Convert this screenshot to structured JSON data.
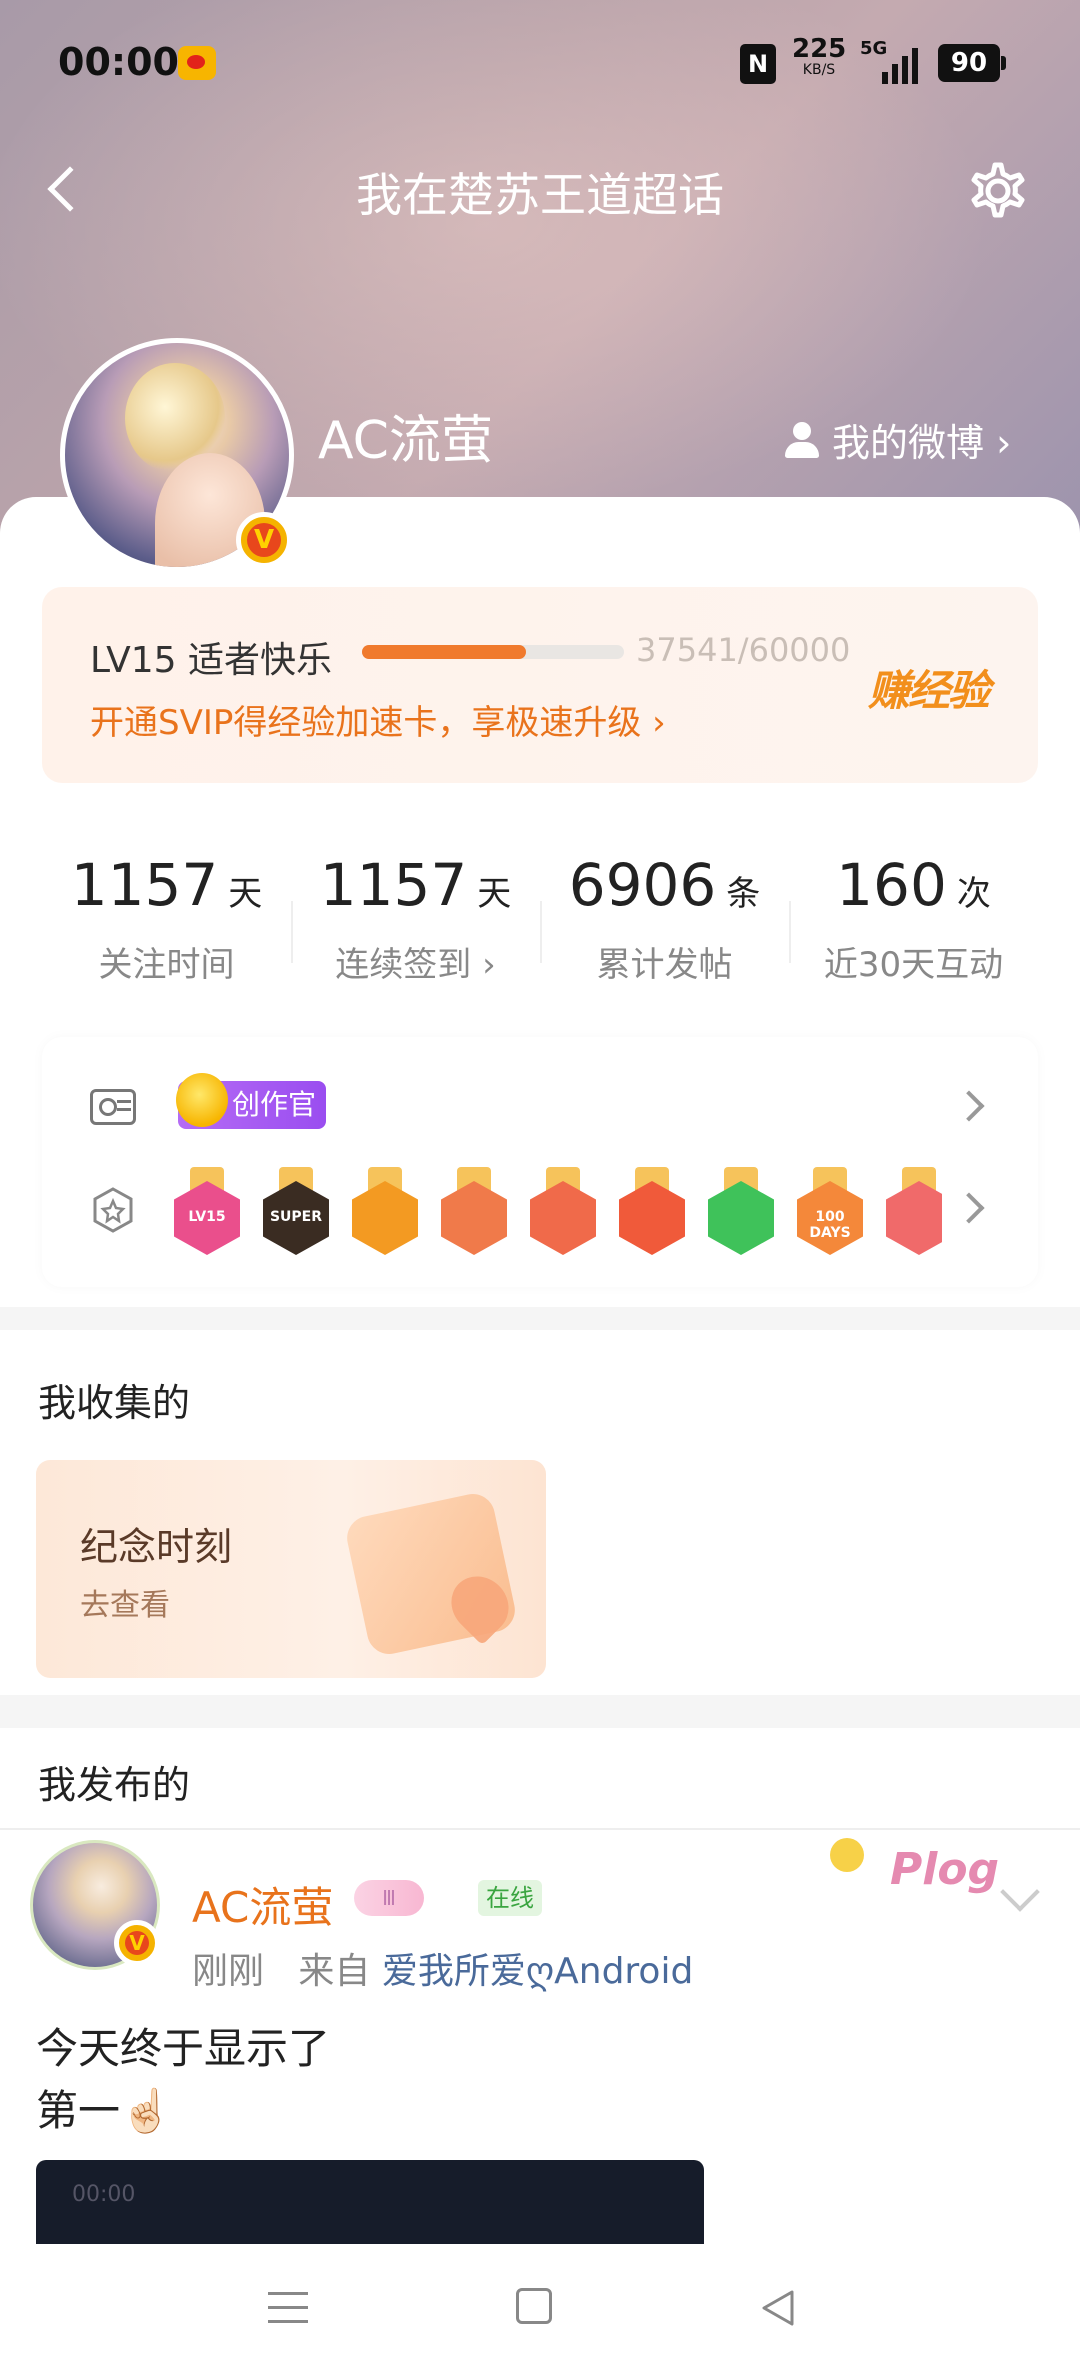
{
  "status_bar": {
    "time": "00:00",
    "nfc": "N",
    "speed_value": "225",
    "speed_unit": "KB/S",
    "network": "5G",
    "battery": "90"
  },
  "header": {
    "title": "我在楚苏王道超话",
    "username": "AC流萤",
    "my_weibo_label": "我的微博 ›"
  },
  "level": {
    "title": "LV15 适者快乐",
    "progress_text": "37541/60000",
    "progress_fraction": 0.6257,
    "promo": "开通SVIP得经验加速卡，享极速升级 ›",
    "earn_label": "赚经验"
  },
  "stats": [
    {
      "value": "1157",
      "unit": "天",
      "label": "关注时间"
    },
    {
      "value": "1157",
      "unit": "天",
      "label": "连续签到 ›"
    },
    {
      "value": "6906",
      "unit": "条",
      "label": "累计发帖"
    },
    {
      "value": "160",
      "unit": "次",
      "label": "近30天互动"
    }
  ],
  "badges": {
    "creator_tag": "创作官",
    "medals": [
      {
        "name": "lv15-medal",
        "label": "LV15",
        "color": "#ea4f8c",
        "ribbon": "#f6c35b"
      },
      {
        "name": "super-medal",
        "label": "SUPER",
        "color": "#3a2c22",
        "ribbon": "#f6c35b"
      },
      {
        "name": "crown-medal",
        "label": "",
        "color": "#f39a22",
        "ribbon": "#f6c35b"
      },
      {
        "name": "cat-medal-1",
        "label": "",
        "color": "#f07a4a",
        "ribbon": "#f6c35b"
      },
      {
        "name": "cat-medal-2",
        "label": "",
        "color": "#f06a4a",
        "ribbon": "#f6c35b"
      },
      {
        "name": "cat-medal-3",
        "label": "",
        "color": "#f05a3a",
        "ribbon": "#f6c35b"
      },
      {
        "name": "hand-medal",
        "label": "",
        "color": "#3fc25a",
        "ribbon": "#f6c35b"
      },
      {
        "name": "100-days-medal",
        "label": "100 DAYS",
        "color": "#f4883a",
        "ribbon": "#f6c35b"
      },
      {
        "name": "partial-medal",
        "label": "",
        "color": "#f06a6a",
        "ribbon": "#f6c35b"
      }
    ]
  },
  "collected": {
    "title": "我收集的",
    "card_title": "纪念时刻",
    "card_sub": "去查看"
  },
  "published": {
    "title": "我发布的",
    "post": {
      "author": "AC流萤",
      "vip": "Ⅲ",
      "online": "在线",
      "plog": "Plog",
      "time": "刚刚",
      "from_prefix": "来自",
      "source": "爱我所爱ღAndroid",
      "text_line1": "今天终于显示了",
      "text_line2": "第一☝🏻",
      "image_time": "00:00"
    }
  },
  "colors": {
    "accent_orange": "#e8731c",
    "progress_fill": "#f07a2d",
    "creator_purple": "#9a4df0"
  }
}
